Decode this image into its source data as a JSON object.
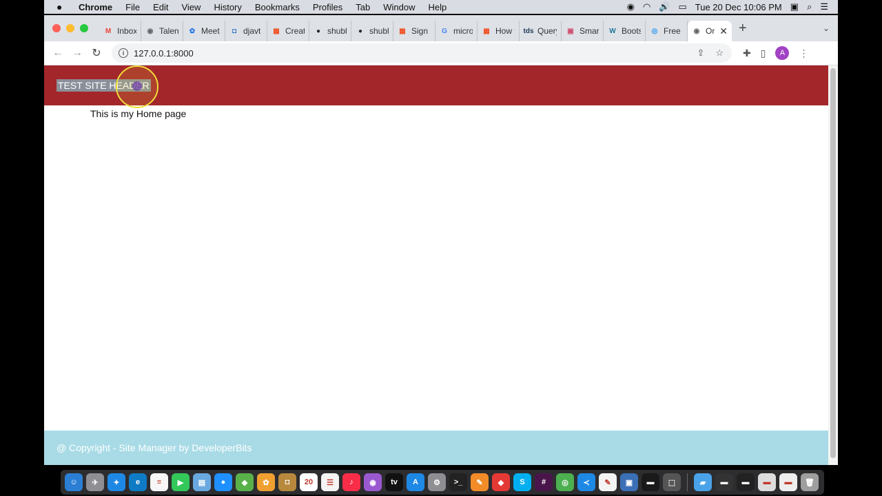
{
  "menubar": {
    "app_name": "Chrome",
    "items": [
      "File",
      "Edit",
      "View",
      "History",
      "Bookmarks",
      "Profiles",
      "Tab",
      "Window",
      "Help"
    ],
    "clock": "Tue 20 Dec  10:06 PM"
  },
  "tabs": [
    {
      "label": "Inbox",
      "fav": "M",
      "color": "#ea4335"
    },
    {
      "label": "Talent",
      "fav": "◉",
      "color": "#5f6368"
    },
    {
      "label": "Meet",
      "fav": "✿",
      "color": "#1a73e8"
    },
    {
      "label": "djavt",
      "fav": "◘",
      "color": "#1565c0"
    },
    {
      "label": "Creat",
      "fav": "▦",
      "color": "#f25022"
    },
    {
      "label": "shubl",
      "fav": "●",
      "color": "#24292e"
    },
    {
      "label": "shubl",
      "fav": "●",
      "color": "#24292e"
    },
    {
      "label": "Sign i",
      "fav": "▦",
      "color": "#f25022"
    },
    {
      "label": "micro",
      "fav": "G",
      "color": "#4285f4"
    },
    {
      "label": "How t",
      "fav": "▦",
      "color": "#f25022"
    },
    {
      "label": "Query",
      "fav": "tds",
      "color": "#1f3b5a"
    },
    {
      "label": "Smar",
      "fav": "▣",
      "color": "#d04a6a"
    },
    {
      "label": "Boots",
      "fav": "W",
      "color": "#21759b"
    },
    {
      "label": "Free",
      "fav": "◎",
      "color": "#2196f3"
    }
  ],
  "active_tab": {
    "label": "Or",
    "fav": "◉",
    "color": "#5f6368"
  },
  "address_bar": {
    "url": "127.0.0.1:8000"
  },
  "profile_initial": "A",
  "site": {
    "header_title": "TEST SITE HEADER",
    "body_text": "This is my Home page",
    "footer_text": "@ Copyright - Site Manager by DeveloperBits",
    "header_color": "#a3262a",
    "footer_color": "#a8dbe6"
  },
  "dock": [
    {
      "name": "finder",
      "color": "#2a7fd4",
      "glyph": "☺"
    },
    {
      "name": "launchpad",
      "color": "#8e8e93",
      "glyph": "✈"
    },
    {
      "name": "safari",
      "color": "#1e88e5",
      "glyph": "✦"
    },
    {
      "name": "edge",
      "color": "#0f7bc4",
      "glyph": "e"
    },
    {
      "name": "notes",
      "color": "#f6f6f6",
      "glyph": "≡"
    },
    {
      "name": "facetime",
      "color": "#34c759",
      "glyph": "▶"
    },
    {
      "name": "preview",
      "color": "#6aa9e0",
      "glyph": "▤"
    },
    {
      "name": "messages",
      "color": "#1e90ff",
      "glyph": "●"
    },
    {
      "name": "maps",
      "color": "#59b14a",
      "glyph": "◆"
    },
    {
      "name": "photos",
      "color": "#f0a030",
      "glyph": "✿"
    },
    {
      "name": "contacts",
      "color": "#b8893d",
      "glyph": "◘"
    },
    {
      "name": "calendar",
      "color": "#ffffff",
      "glyph": "20"
    },
    {
      "name": "reminders",
      "color": "#f4f4f4",
      "glyph": "☰"
    },
    {
      "name": "music",
      "color": "#fa2d48",
      "glyph": "♪"
    },
    {
      "name": "podcasts",
      "color": "#9b59d0",
      "glyph": "◉"
    },
    {
      "name": "tv",
      "color": "#111111",
      "glyph": "tv"
    },
    {
      "name": "app-store",
      "color": "#1e88e5",
      "glyph": "A"
    },
    {
      "name": "system-preferences",
      "color": "#8e8e93",
      "glyph": "⚙"
    },
    {
      "name": "terminal",
      "color": "#222222",
      "glyph": ">_"
    },
    {
      "name": "sketch",
      "color": "#f28c28",
      "glyph": "✎"
    },
    {
      "name": "anydesk",
      "color": "#e53935",
      "glyph": "◆"
    },
    {
      "name": "skype",
      "color": "#00aff0",
      "glyph": "S"
    },
    {
      "name": "slack",
      "color": "#4a154b",
      "glyph": "#"
    },
    {
      "name": "chrome",
      "color": "#4caf50",
      "glyph": "◎"
    },
    {
      "name": "vscode",
      "color": "#1e88e5",
      "glyph": "≺"
    },
    {
      "name": "textedit",
      "color": "#f4f4f4",
      "glyph": "✎"
    },
    {
      "name": "virtualbox",
      "color": "#3b6fb6",
      "glyph": "▣"
    },
    {
      "name": "terminal-window",
      "color": "#1a1a1a",
      "glyph": "▬"
    },
    {
      "name": "screenshot",
      "color": "#555555",
      "glyph": "⬚"
    },
    {
      "name": "downloads-folder",
      "color": "#4aa3e8",
      "glyph": "▰"
    },
    {
      "name": "window-thumb-1",
      "color": "#333333",
      "glyph": "▬"
    },
    {
      "name": "window-thumb-2",
      "color": "#222222",
      "glyph": "▬"
    },
    {
      "name": "window-thumb-3",
      "color": "#dddddd",
      "glyph": "▬"
    },
    {
      "name": "window-thumb-4",
      "color": "#eeeeee",
      "glyph": "▬"
    },
    {
      "name": "trash",
      "color": "#9e9e9e",
      "glyph": "🗑"
    }
  ]
}
